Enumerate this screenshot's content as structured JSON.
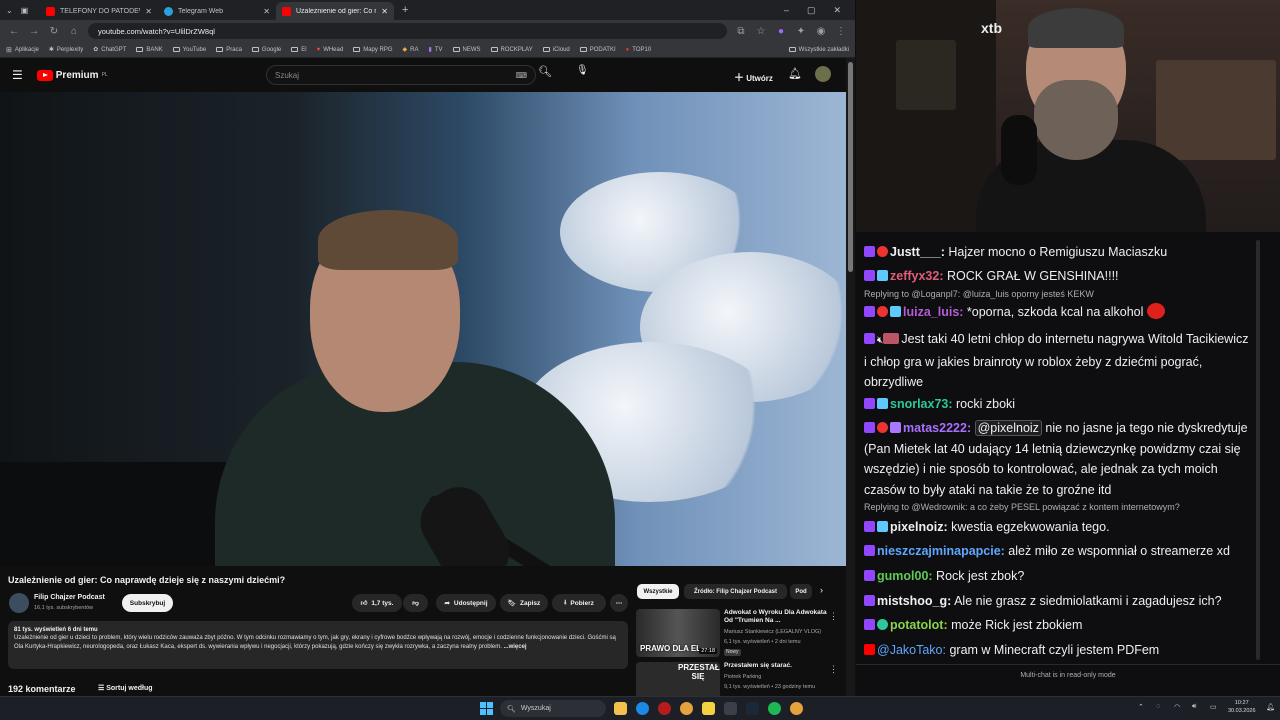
{
  "browser": {
    "tabs": [
      {
        "title": "TELEFONY DO PATODEWELOPE",
        "color": "#ff0000"
      },
      {
        "title": "Telegram Web",
        "color": "#2aa1da"
      },
      {
        "title": "Uzależnienie od gier: Co n",
        "color": "#ff0000"
      }
    ],
    "new_tab": "+",
    "url": "youtube.com/watch?v=UlilDrZW8ql",
    "bookmarks": [
      "Aplikacje",
      "Perplexity",
      "ChatGPT",
      "BANK",
      "YouTube",
      "Praca",
      "Google",
      "El",
      "WHead",
      "Mapy RPG",
      "RA",
      "TV",
      "NEWS",
      "ROCKPLAY",
      "iCloud",
      "PODATKI",
      "TOP10"
    ],
    "all_bookmarks": "Wszystkie zakładki"
  },
  "youtube": {
    "logo_text": "Premium",
    "logo_sup": "PL",
    "search_placeholder": "Szukaj",
    "create_label": "Utwórz",
    "video_title": "Uzależnienie od gier: Co naprawdę dzieje się z naszymi dziećmi?",
    "channel_name": "Filip Chajzer Podcast",
    "channel_subs": "16,1 tys. subskrybentów",
    "subscribe_label": "Subskrybuj",
    "like_count": "1,7 tys.",
    "share_label": "Udostępnij",
    "save_label": "Zapisz",
    "download_label": "Pobierz",
    "description_meta": "81 tys. wyświetleń  6 dni temu",
    "description_text": "Uzależnienie od gier u dzieci to problem, który wielu rodziców zauważa zbyt późno. W tym odcinku rozmawiamy o tym, jak gry, ekrany i cyfrowe bodźce wpływają na rozwój, emocje i codzienne funkcjonowanie dzieci. Gośćmi są Ola Kurtyka-Hrapkiewicz, neurologopeda, oraz Łukasz Kaca, ekspert ds. wywierania wpływu i negocjacji, którzy pokazują, gdzie kończy się zwykła rozrywka, a zaczyna realny problem.",
    "description_more": "...więcej",
    "comments_count": "192 komentarze",
    "sort_label": "Sortuj według",
    "chips": [
      "Wszystkie",
      "Źródło: Filip Chajzer Podcast",
      "Pod"
    ],
    "recommendations": [
      {
        "title": "Adwokat o Wyroku Dla Adwokata Od \"Trumien Na ...",
        "channel": "Mariusz Stankiewicz (LEGALNY VLOG)",
        "meta": "6,1 tys. wyświetleń • 2 dni temu",
        "badge": "Nowy",
        "thumb_text": "PRAWO DLA EL",
        "duration": "27:18"
      },
      {
        "title": "Przestałem się starać.",
        "channel": "Piotrek Parking",
        "meta": "9,1 tys. wyświetleń • 23 godziny temu",
        "badge": "",
        "thumb_text": "PRZESTAŁEM SIĘ",
        "duration": ""
      }
    ]
  },
  "chat": {
    "messages": [
      {
        "platform": "tw",
        "user": "Justt___:",
        "color": "#efeff1",
        "text": " Hajzer mocno o Remigiuszu Maciaszku"
      },
      {
        "platform": "tw",
        "user": "zeffyx32:",
        "color": "#e05d7b",
        "text": " ROCK GRAŁ W GENSHINA!!!!"
      },
      {
        "platform": "tw",
        "user": "luiza_luis:",
        "color": "#b55bd6",
        "text": "  *oporna, szkoda kcal na alkohol"
      },
      {
        "platform": "tw",
        "user": "",
        "color": "#efeff1",
        "text": "Jest taki 40 letni chłop do internetu nagrywa Witold Tacikiewicz i chłop gra w jakies brainroty w roblox żeby z dziećmi pograć, obrzydliwe"
      },
      {
        "platform": "tw",
        "user": "snorlax73:",
        "color": "#2ec79b",
        "text": " rocki zboki"
      },
      {
        "platform": "tw",
        "user": "matas2222:",
        "color": "#a970ff",
        "mention": "@pixelnoiz",
        "text": " nie no jasne ja tego nie dyskredytuje (Pan Mietek lat 40 udający 14 letnią dziewczynkę powidzmy czai się wszędzie) i nie sposób to kontrolować, ale jednak za tych moich czasów to były ataki na takie że to groźne itd"
      },
      {
        "platform": "tw",
        "user": "pixelnoiz:",
        "color": "#efeff1",
        "text": "  kwestia egzekwowania tego."
      },
      {
        "platform": "tw",
        "user": "nieszczajminapapcie:",
        "color": "#5ea7ff",
        "text": " ależ miło ze wspomniał o streamerze xd"
      },
      {
        "platform": "tw",
        "user": "gumol00:",
        "color": "#60c956",
        "text": " Rock jest zbok?"
      },
      {
        "platform": "tw",
        "user": "mistshoo_g:",
        "color": "#efeff1",
        "text": " Ale nie grasz z siedmiolatkami i zagadujesz ich?"
      },
      {
        "platform": "tw",
        "user": "potatolot:",
        "color": "#8bd34b",
        "text": " może Rick jest zbokiem"
      },
      {
        "platform": "yt",
        "user": "@JakoTako:",
        "color": "#5ea7ff",
        "text": " gram w Minecraft czyli jestem PDFem"
      }
    ],
    "replies": [
      "Replying to @Loganpl7: @luiza_luis oporny jesteś KEKW",
      "Replying to @Wedrownik: a co żeby PESEL powiązać z kontem internetowym?"
    ],
    "footer": "Multi-chat is in read-only mode"
  },
  "webcam": {
    "sign": "xtb"
  },
  "taskbar": {
    "search": "Wyszukaj",
    "time": "10:27",
    "date": "30.03.2026"
  }
}
